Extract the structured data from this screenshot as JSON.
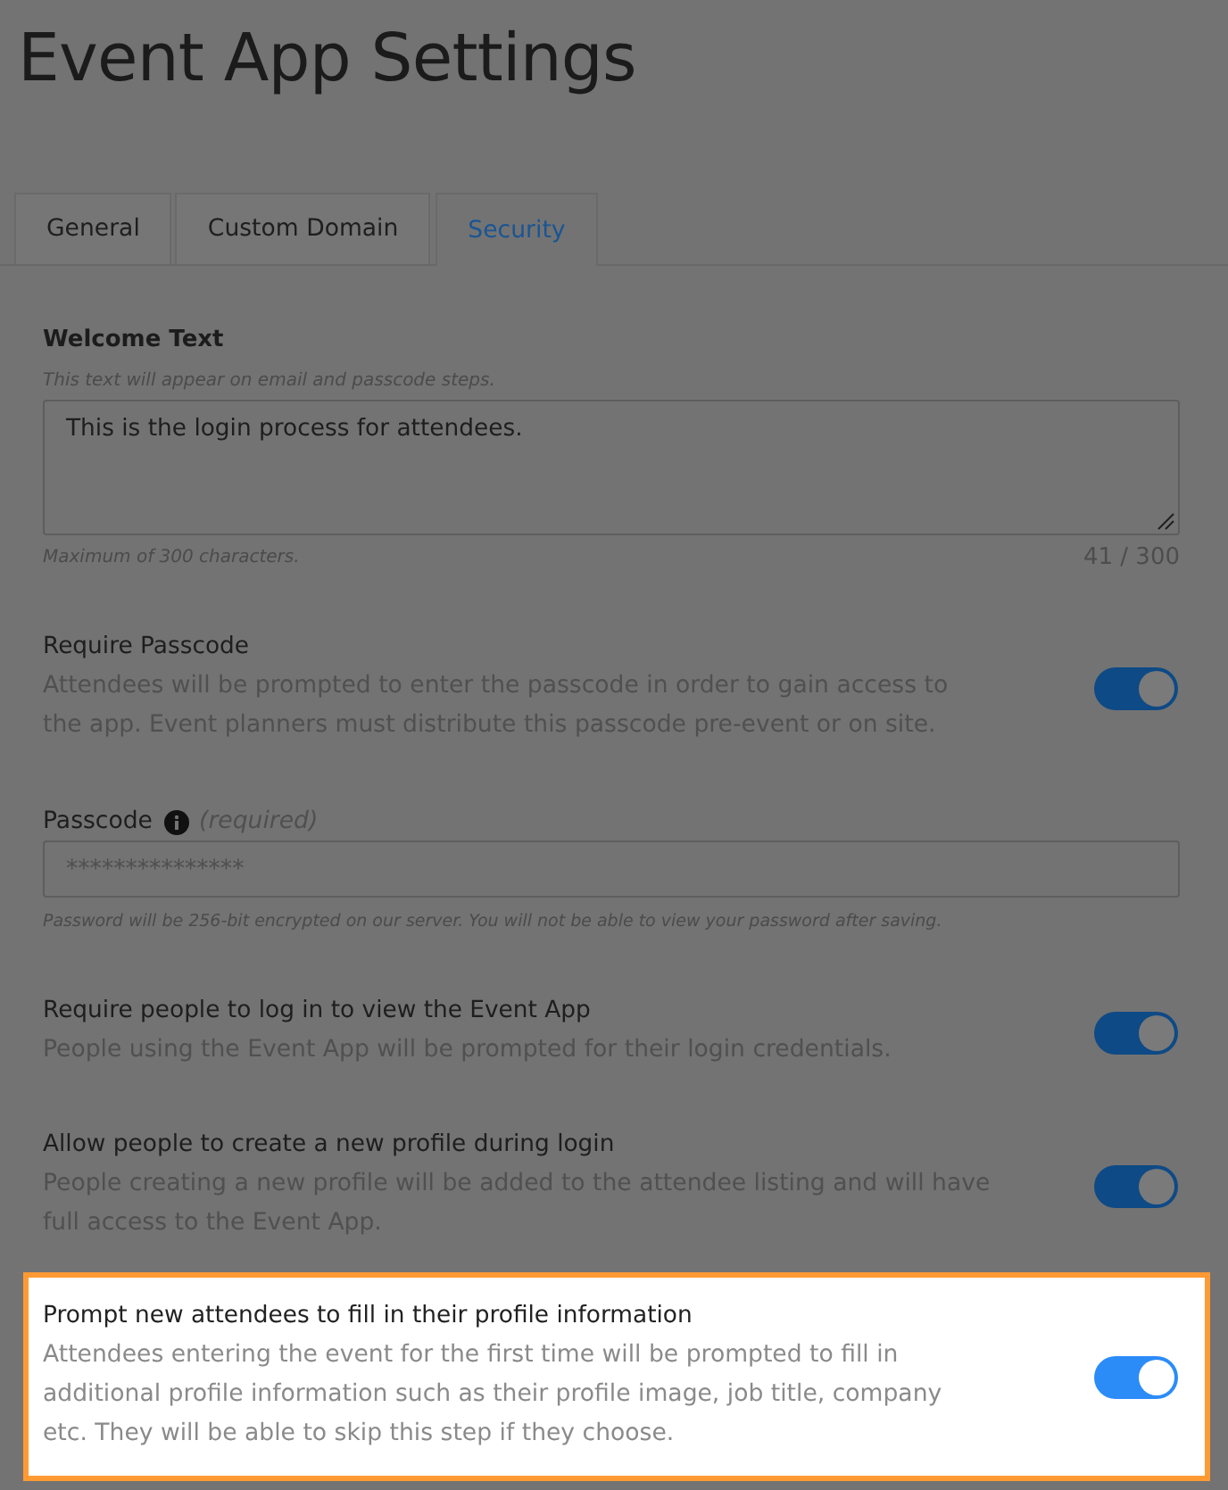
{
  "page": {
    "title": "Event App Settings"
  },
  "tabs": [
    {
      "label": "General",
      "selected": false
    },
    {
      "label": "Custom Domain",
      "selected": false
    },
    {
      "label": "Security",
      "selected": true
    }
  ],
  "welcome_text": {
    "label": "Welcome Text",
    "hint": "This text will appear on email and passcode steps.",
    "value": "This is the login process for attendees.",
    "note": "Maximum of 300 characters.",
    "counter": "41 / 300"
  },
  "settings": [
    {
      "kind": "toggle",
      "title": "Require Passcode",
      "description": "Attendees will be prompted to enter the passcode in order to gain access to the app. Event planners must distribute this passcode pre-event or on site.",
      "on": true,
      "highlighted": false
    },
    {
      "kind": "field",
      "label": "Passcode",
      "qualifier": "(required)",
      "placeholder": "***************",
      "note": "Password will be 256-bit encrypted on our server. You will not be able to view your password after saving."
    },
    {
      "kind": "toggle",
      "title": "Require people to log in to view the Event App",
      "description": "People using the Event App will be prompted for their login credentials.",
      "on": true,
      "highlighted": false
    },
    {
      "kind": "toggle",
      "title": "Allow people to create a new profile during login",
      "description": "People creating a new profile will be added to the attendee listing and will have full access to the Event App.",
      "on": true,
      "highlighted": false
    },
    {
      "kind": "toggle",
      "title": "Prompt new attendees to fill in their profile information",
      "description": "Attendees entering the event for the first time will be prompted to fill in additional profile information such as their profile image, job title, company etc. They will be able to skip this step if they choose.",
      "on": true,
      "highlighted": true
    }
  ]
}
